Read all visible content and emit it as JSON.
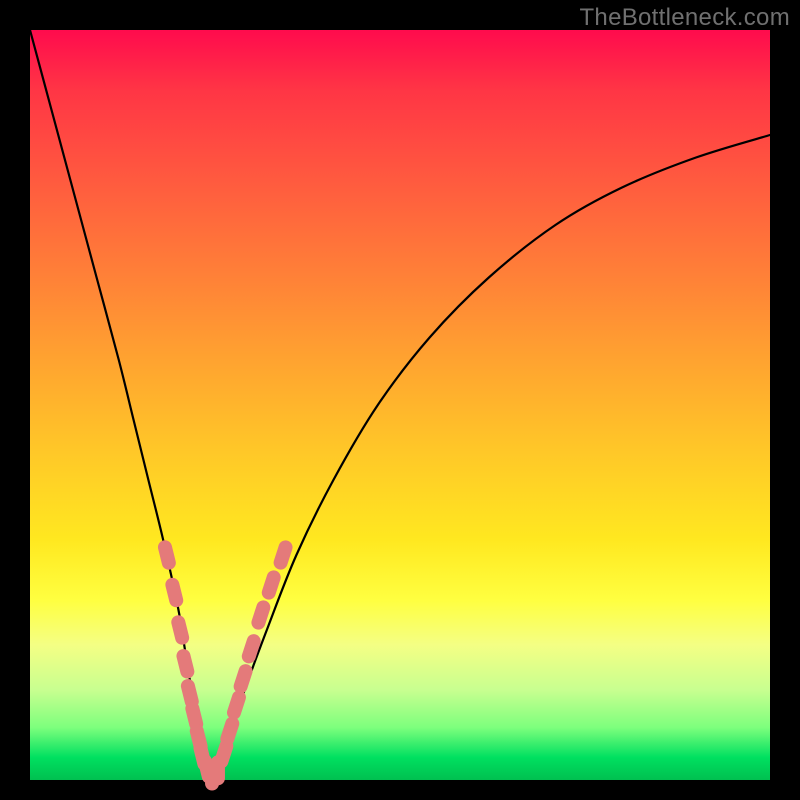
{
  "watermark": "TheBottleneck.com",
  "colors": {
    "frame": "#000000",
    "curve_stroke": "#000000",
    "marker_fill": "#e47a7a",
    "marker_stroke": "#d86a6a",
    "gradient_top": "#ff0b4d",
    "gradient_bottom": "#00c050"
  },
  "chart_data": {
    "type": "line",
    "title": "",
    "xlabel": "",
    "ylabel": "",
    "xlim": [
      0,
      100
    ],
    "ylim": [
      0,
      100
    ],
    "grid": false,
    "legend": false,
    "note": "V-shaped bottleneck curve. x runs 0→100 left→right across the gradient area; y is 0 at the bottom edge and 100 at the top edge. Values are visual estimates from pixel positions.",
    "series": [
      {
        "name": "bottleneck-curve",
        "x": [
          0,
          3,
          6,
          9,
          12,
          14,
          16,
          18,
          20,
          21,
          22,
          23,
          23.7,
          24.5,
          25.5,
          27,
          29,
          32,
          36,
          41,
          47,
          54,
          62,
          71,
          80,
          90,
          100
        ],
        "y": [
          100,
          89,
          78,
          67,
          56,
          48,
          40,
          32,
          23,
          17,
          11,
          6,
          2.5,
          0.5,
          1.5,
          6,
          12,
          20,
          30,
          40,
          50,
          59,
          67,
          74,
          79,
          83,
          86
        ]
      }
    ],
    "markers": {
      "name": "highlighted-points",
      "note": "Salmon pill-shaped markers clustered near the bottom of the V on both branches.",
      "points": [
        {
          "x": 18.5,
          "y": 30
        },
        {
          "x": 19.5,
          "y": 25
        },
        {
          "x": 20.3,
          "y": 20
        },
        {
          "x": 21.0,
          "y": 15.5
        },
        {
          "x": 21.6,
          "y": 11.5
        },
        {
          "x": 22.2,
          "y": 8.5
        },
        {
          "x": 22.8,
          "y": 5.5
        },
        {
          "x": 23.3,
          "y": 3.2
        },
        {
          "x": 23.9,
          "y": 1.5
        },
        {
          "x": 24.6,
          "y": 0.6
        },
        {
          "x": 25.4,
          "y": 1.3
        },
        {
          "x": 26.2,
          "y": 3.5
        },
        {
          "x": 27.0,
          "y": 6.5
        },
        {
          "x": 27.9,
          "y": 10
        },
        {
          "x": 28.8,
          "y": 13.5
        },
        {
          "x": 29.9,
          "y": 17.5
        },
        {
          "x": 31.2,
          "y": 22
        },
        {
          "x": 32.6,
          "y": 26
        },
        {
          "x": 34.2,
          "y": 30
        }
      ]
    }
  }
}
